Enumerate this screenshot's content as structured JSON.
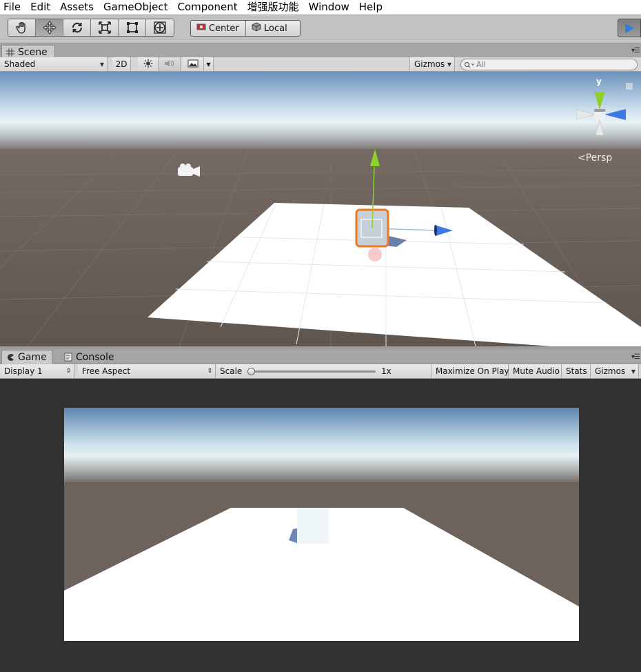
{
  "menu": [
    "File",
    "Edit",
    "Assets",
    "GameObject",
    "Component",
    "增强版功能",
    "Window",
    "Help"
  ],
  "toolbar": {
    "tools": [
      {
        "name": "hand-tool",
        "icon": "hand-icon"
      },
      {
        "name": "move-tool",
        "icon": "move-arrows-icon"
      },
      {
        "name": "rotate-tool",
        "icon": "rotate-icon"
      },
      {
        "name": "scale-tool",
        "icon": "scale-icon"
      },
      {
        "name": "rect-tool",
        "icon": "rect-icon"
      },
      {
        "name": "transform-tool",
        "icon": "transform-icon"
      }
    ],
    "pivot_label": "Center",
    "space_label": "Local"
  },
  "scene": {
    "tab_label": "Scene",
    "shading_mode": "Shaded",
    "mode_2d": "2D",
    "gizmos_label": "Gizmos",
    "search_placeholder": "All",
    "projection_label": "Persp",
    "gizmo_y_label": "y"
  },
  "game": {
    "tab_label": "Game",
    "console_tab_label": "Console",
    "display": "Display 1",
    "aspect": "Free Aspect",
    "scale_label": "Scale",
    "scale_value": "1x",
    "maximize_on_play": "Maximize On Play",
    "mute_audio": "Mute Audio",
    "stats": "Stats",
    "gizmos_label": "Gizmos"
  },
  "colors": {
    "sky_top": "#5f88b3",
    "horizon": "#e2eef4",
    "ground": "#6d625c",
    "plane": "#ffffff",
    "selection_outline": "#f07819",
    "axis_y": "#8dd22a",
    "axis_z": "#3c78e6",
    "play_blue": "#2f7de0"
  }
}
